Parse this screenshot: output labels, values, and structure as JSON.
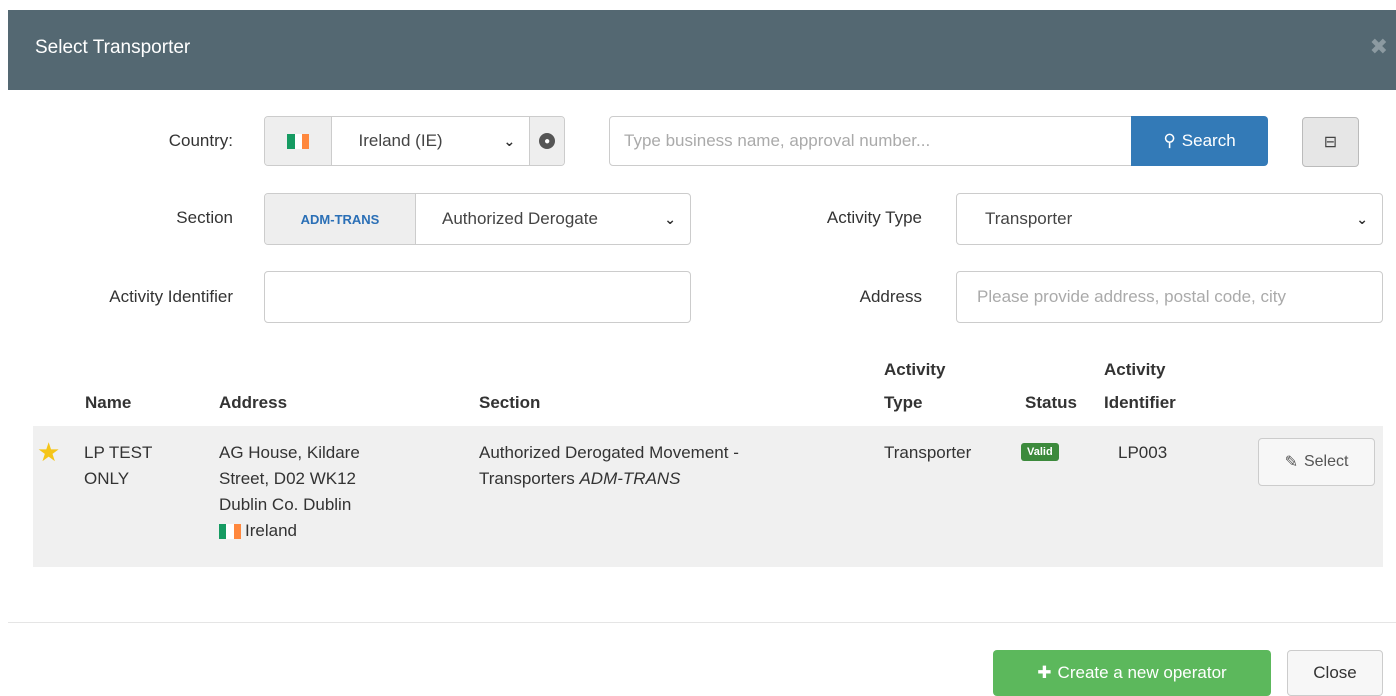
{
  "modal": {
    "title": "Select Transporter",
    "close_icon": "close-icon"
  },
  "filters": {
    "country_label": "Country:",
    "country_value": "Ireland (IE)",
    "search_placeholder": "Type business name, approval number...",
    "search_button": "Search",
    "section_label": "Section",
    "section_code": "ADM-TRANS",
    "section_value": "Authorized Derogate",
    "activity_type_label": "Activity Type",
    "activity_type_value": "Transporter",
    "activity_identifier_label": "Activity Identifier",
    "activity_identifier_value": "",
    "address_label": "Address",
    "address_placeholder": "Please provide address, postal code, city"
  },
  "table": {
    "headers": {
      "name": "Name",
      "address": "Address",
      "section": "Section",
      "activity_type_1": "Activity",
      "activity_type_2": "Type",
      "status": "Status",
      "activity_identifier_1": "Activity",
      "activity_identifier_2": "Identifier"
    },
    "rows": [
      {
        "name_1": "LP TEST",
        "name_2": "ONLY",
        "address_1": "AG House, Kildare",
        "address_2": "Street, D02 WK12",
        "address_3": "Dublin Co. Dublin",
        "address_country": "Ireland",
        "section_1": "Authorized Derogated Movement -",
        "section_2": "Transporters",
        "section_code": "ADM-TRANS",
        "activity_type": "Transporter",
        "status": "Valid",
        "activity_identifier": "LP003",
        "select_label": "Select"
      }
    ]
  },
  "footer": {
    "create_label": "Create a new operator",
    "close_label": "Close"
  },
  "colors": {
    "header_bg": "#546872",
    "primary": "#337ab7",
    "success": "#5cb85c",
    "valid_badge": "#3c8a3c",
    "star": "#f5c518"
  }
}
